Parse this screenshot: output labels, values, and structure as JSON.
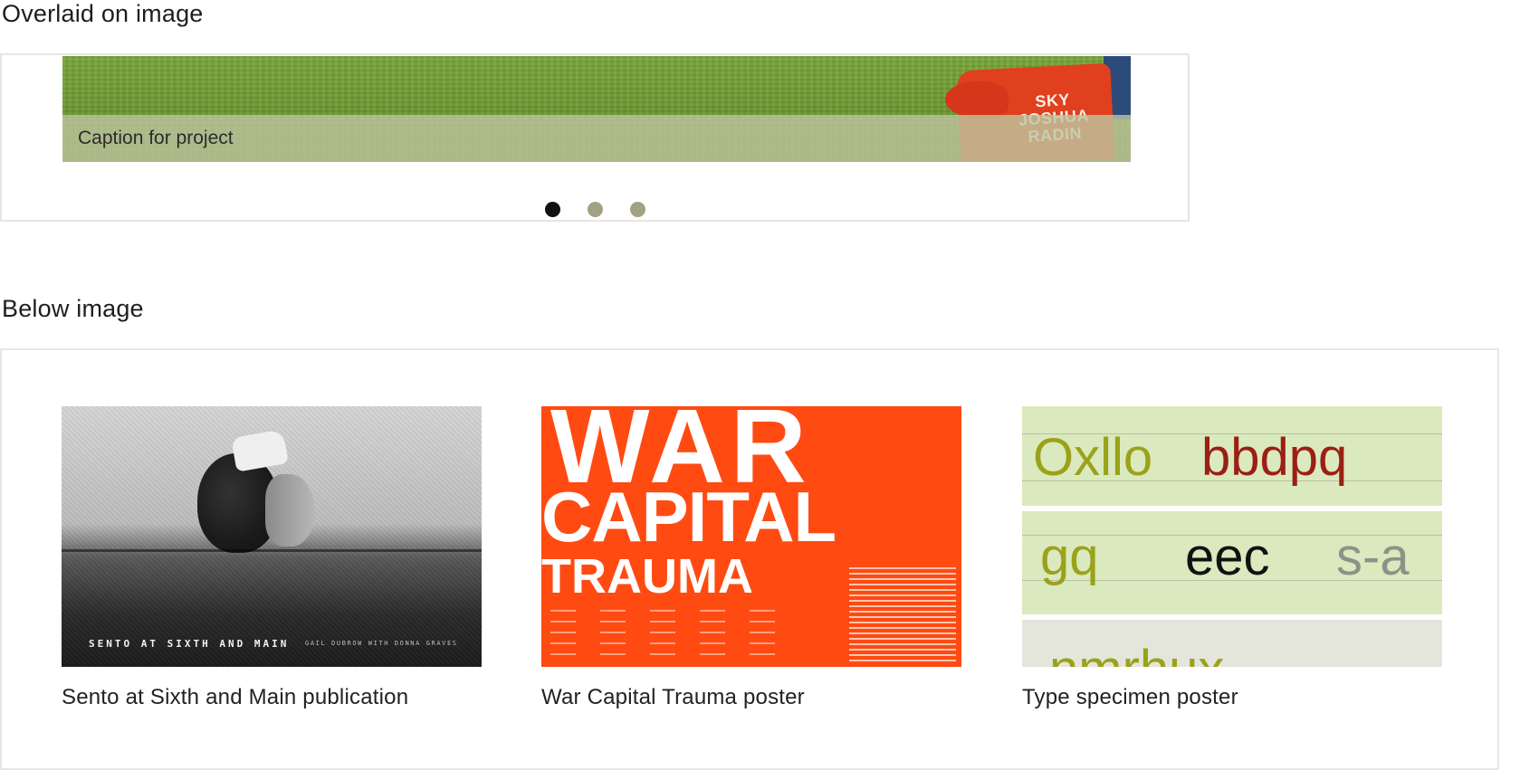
{
  "sections": {
    "overlaid_heading": "Overlaid on image",
    "below_heading": "Below image"
  },
  "carousel": {
    "caption": "Caption for project",
    "bag_text": "SKY JOSHUA RADIN",
    "slide_count": 3,
    "active_index": 0
  },
  "cards": [
    {
      "title": "Sento at Sixth and Main publication",
      "image_text": "SENTO AT SIXTH AND MAIN",
      "image_subtext": "GAIL DUBROW WITH DONNA GRAVES"
    },
    {
      "title": "War Capital Trauma poster",
      "image_text_1": "WAR",
      "image_text_2": "CAPITAL",
      "image_text_3": "TRAUMA"
    },
    {
      "title": "Type specimen poster",
      "glyph_row_1a": "Oxllo",
      "glyph_row_1b": "bbdpq",
      "glyph_row_2a": "gq",
      "glyph_row_2b": "eec",
      "glyph_row_2c": "s-a",
      "glyph_row_3": "nmrhux"
    }
  ],
  "colors": {
    "dot_active": "#111111",
    "dot_inactive": "#a3a184",
    "caption_overlay": "#bec6a0",
    "poster_orange": "#ff4a12",
    "specimen_green": "#dbe9be"
  }
}
